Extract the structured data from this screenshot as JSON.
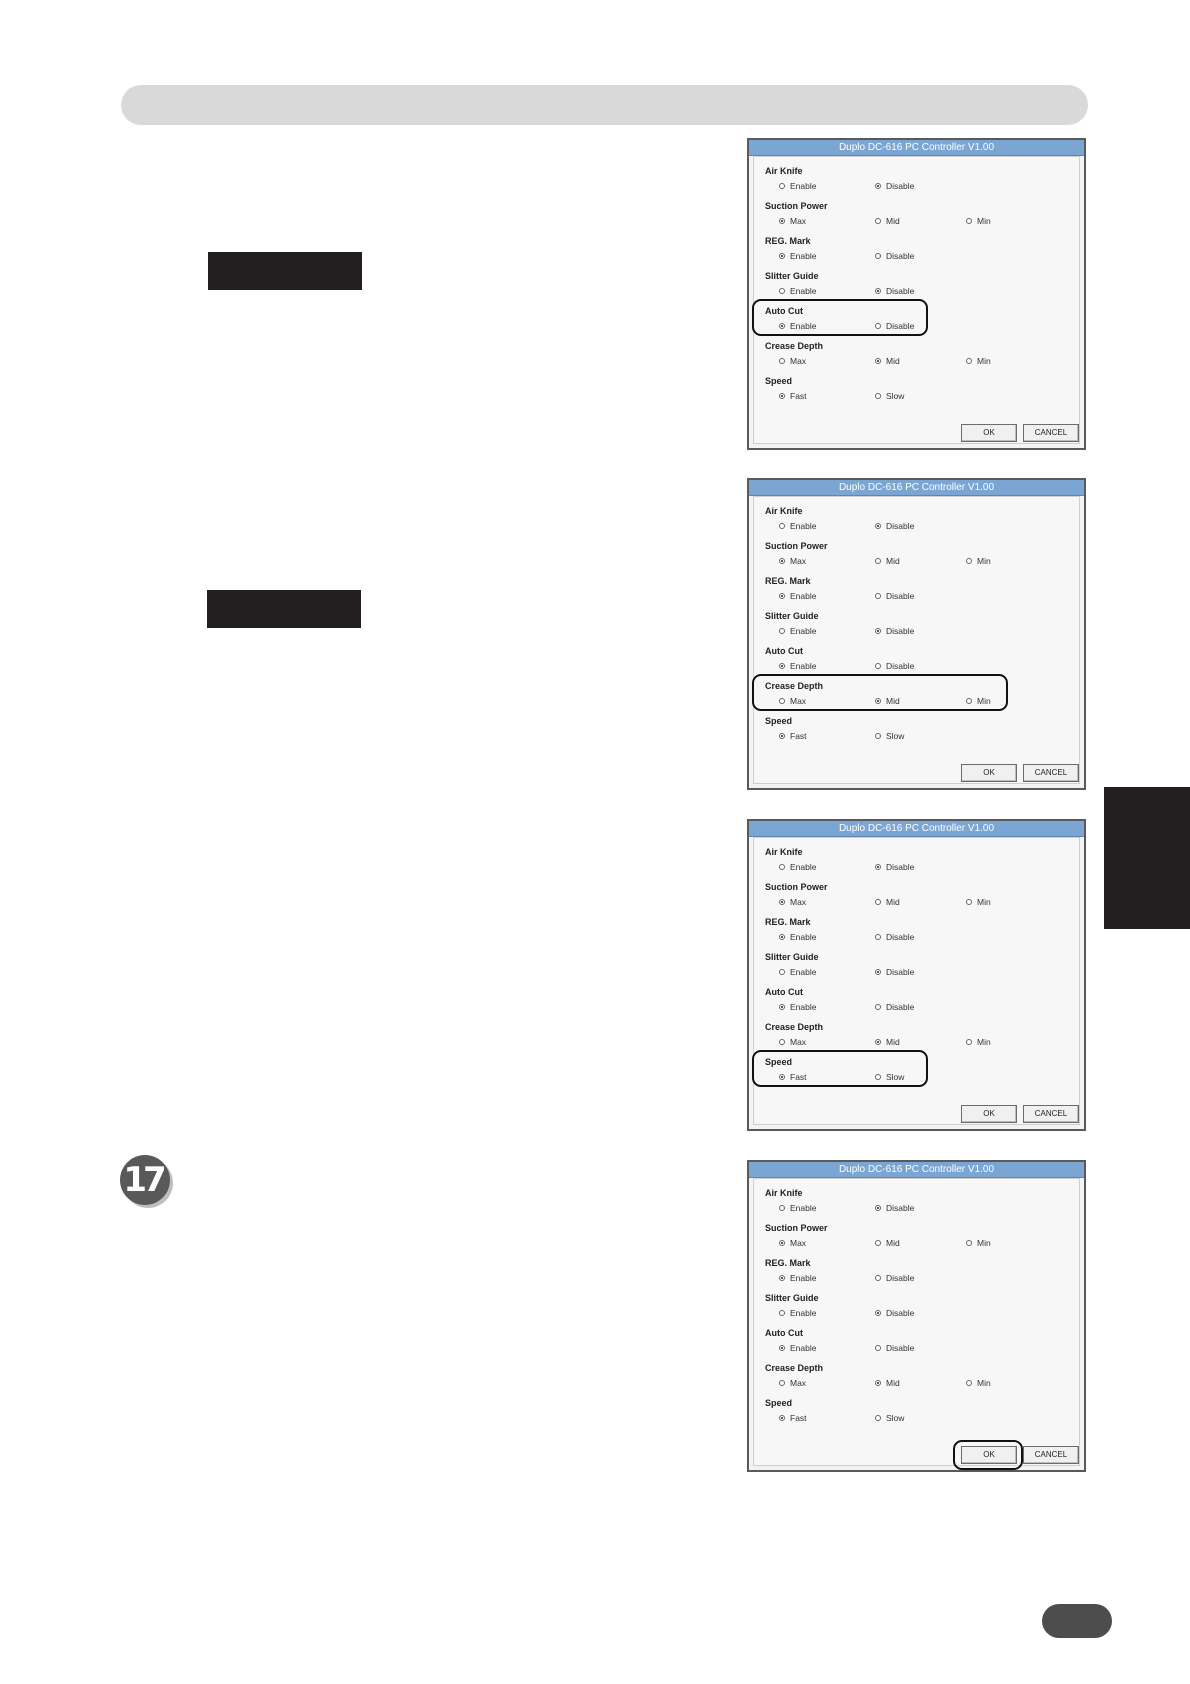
{
  "dialog": {
    "title": "Duplo DC-616 PC Controller V1.00",
    "ok_label": "OK",
    "cancel_label": "CANCEL",
    "groups": [
      {
        "label": "Air Knife",
        "options": [
          "Enable",
          "Disable"
        ],
        "selected": "Disable"
      },
      {
        "label": "Suction Power",
        "options": [
          "Max",
          "Mid",
          "Min"
        ],
        "selected": "Max"
      },
      {
        "label": "REG. Mark",
        "options": [
          "Enable",
          "Disable"
        ],
        "selected": "Enable"
      },
      {
        "label": "Slitter Guide",
        "options": [
          "Enable",
          "Disable"
        ],
        "selected": "Disable"
      },
      {
        "label": "Auto Cut",
        "options": [
          "Enable",
          "Disable"
        ],
        "selected": "Enable"
      },
      {
        "label": "Crease Depth",
        "options": [
          "Max",
          "Mid",
          "Min"
        ],
        "selected": "Mid"
      },
      {
        "label": "Speed",
        "options": [
          "Fast",
          "Slow"
        ],
        "selected": "Fast"
      }
    ]
  },
  "screenshots": [
    {
      "highlighted": "Auto Cut"
    },
    {
      "highlighted": "Crease Depth"
    },
    {
      "highlighted": "Speed"
    },
    {
      "highlighted": "OK"
    }
  ],
  "step": {
    "number": "17"
  }
}
